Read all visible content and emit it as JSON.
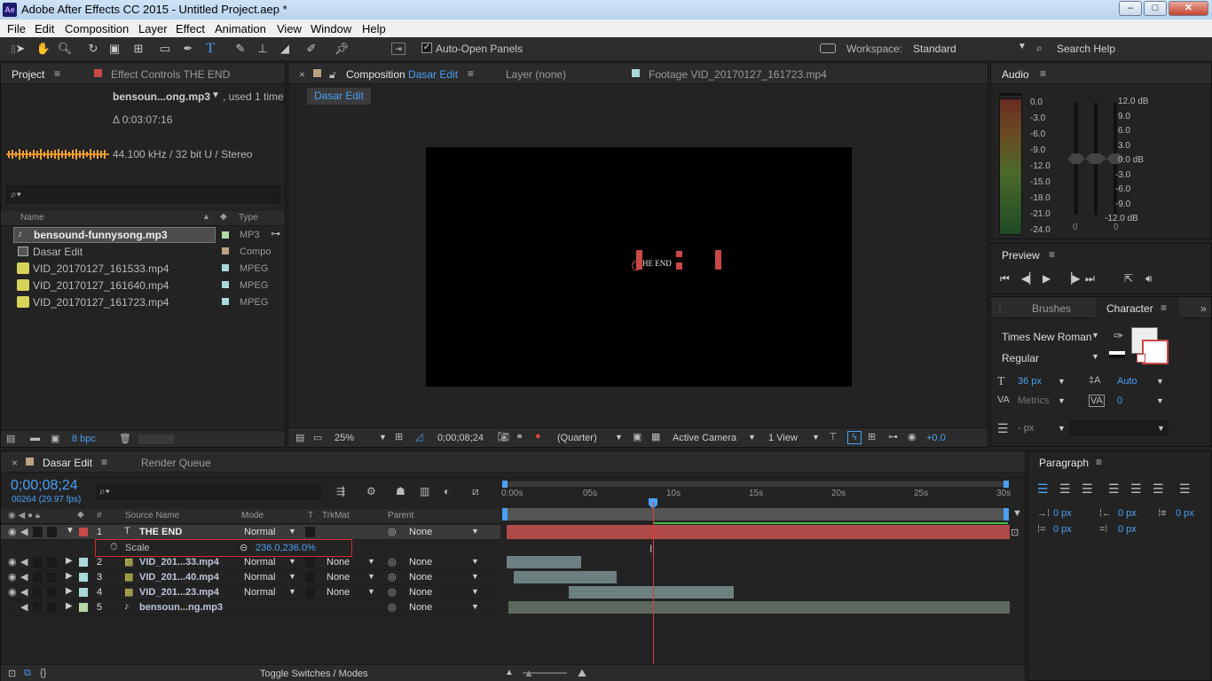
{
  "window": {
    "title": "Adobe After Effects CC 2015 - Untitled Project.aep *",
    "app_icon": "Ae",
    "minimize": "‒",
    "maximize": "□",
    "close": "✕"
  },
  "menu": [
    "File",
    "Edit",
    "Composition",
    "Layer",
    "Effect",
    "Animation",
    "View",
    "Window",
    "Help"
  ],
  "toolbar": {
    "auto_open_panels": "Auto-Open Panels",
    "auto_open_checked": true,
    "workspace_label": "Workspace:",
    "workspace_value": "Standard",
    "search_help": "Search Help"
  },
  "project_panel": {
    "tab_project": "Project",
    "tab_effect_controls": "Effect Controls THE END",
    "selected_name": "bensoun...ong.mp3",
    "used": ", used 1 time",
    "duration": "Δ 0:03:07:16",
    "audio_info": "44.100 kHz / 32 bit U / Stereo",
    "search_placeholder": "",
    "col_name": "Name",
    "col_type": "Type",
    "items": [
      {
        "name": "bensound-funnysong.mp3",
        "type": "MP3",
        "color": "#b4d9a7",
        "selected": true
      },
      {
        "name": "Dasar Edit",
        "type": "Compo",
        "color": "#bba283",
        "selected": false
      },
      {
        "name": "VID_20170127_161533.mp4",
        "type": "MPEG",
        "color": "#a9d9d9",
        "selected": false
      },
      {
        "name": "VID_20170127_161640.mp4",
        "type": "MPEG",
        "color": "#a9d9d9",
        "selected": false
      },
      {
        "name": "VID_20170127_161723.mp4",
        "type": "MPEG",
        "color": "#a9d9d9",
        "selected": false
      }
    ],
    "bpc": "8 bpc"
  },
  "composition_panel": {
    "tab_composition_prefix": "Composition",
    "tab_composition_name": "Dasar Edit",
    "tab_layer": "Layer (none)",
    "tab_footage": "Footage VID_20170127_161723.mp4",
    "breadcrumb": "Dasar Edit",
    "canvas_text": "HE END",
    "zoom": "25%",
    "timecode": "0;00;08;24",
    "resolution": "(Quarter)",
    "camera": "Active Camera",
    "views": "1 View",
    "exposure": "+0.0"
  },
  "audio_panel": {
    "title": "Audio",
    "left_scale": [
      "0.0",
      "-3.0",
      "-6.0",
      "-9.0",
      "-12.0",
      "-15.0",
      "-18.0",
      "-21.0",
      "-24.0"
    ],
    "right_scale": [
      "12.0 dB",
      "9.0",
      "6.0",
      "3.0",
      "0.0 dB",
      "-3.0",
      "-6.0",
      "-9.0",
      "-12.0 dB"
    ],
    "slider_values": [
      "0",
      "0"
    ]
  },
  "preview_panel": {
    "title": "Preview"
  },
  "character_panel": {
    "tab_brushes": "Brushes",
    "tab_character": "Character",
    "font": "Times New Roman",
    "style": "Regular",
    "size": "36 px",
    "leading": "Auto",
    "kerning": "Metrics",
    "tracking": "0",
    "stroke": "- px"
  },
  "paragraph_panel": {
    "title": "Paragraph",
    "indent_left": "0 px",
    "indent_right": "0 px",
    "space_before": "0 px",
    "first_line": "0 px",
    "space_after": "0 px"
  },
  "timeline": {
    "tab_comp": "Dasar Edit",
    "tab_render": "Render Queue",
    "timecode": "0;00;08;24",
    "frame_info": "00264 (29.97 fps)",
    "col_hash": "#",
    "col_source": "Source Name",
    "col_mode": "Mode",
    "col_t": "T",
    "col_trkmat": "TrkMat",
    "col_parent": "Parent",
    "ruler_labels": [
      "0:00s",
      "05s",
      "10s",
      "15s",
      "20s",
      "25s",
      "30s"
    ],
    "layers": [
      {
        "num": "1",
        "name": "THE END",
        "mode": "Normal",
        "trkmat": "",
        "parent": "None",
        "color": "#c94848",
        "icon": "T"
      },
      {
        "num": "2",
        "name": "VID_201...33.mp4",
        "mode": "Normal",
        "trkmat": "None",
        "parent": "None",
        "color": "#a9d9d9",
        "icon": "film"
      },
      {
        "num": "3",
        "name": "VID_201...40.mp4",
        "mode": "Normal",
        "trkmat": "None",
        "parent": "None",
        "color": "#a9d9d9",
        "icon": "film"
      },
      {
        "num": "4",
        "name": "VID_201...23.mp4",
        "mode": "Normal",
        "trkmat": "None",
        "parent": "None",
        "color": "#a9d9d9",
        "icon": "film"
      },
      {
        "num": "5",
        "name": "bensoun...ng.mp3",
        "mode": "",
        "trkmat": "",
        "parent": "None",
        "color": "#b4d9a7",
        "icon": "audio"
      }
    ],
    "scale_label": "Scale",
    "scale_value": "236.0,236.0%",
    "toggle_label": "Toggle Switches / Modes"
  },
  "colors": {
    "accent_blue": "#4aa0f5",
    "text_layer_red": "#c94848",
    "playhead": "#e23b3b"
  }
}
